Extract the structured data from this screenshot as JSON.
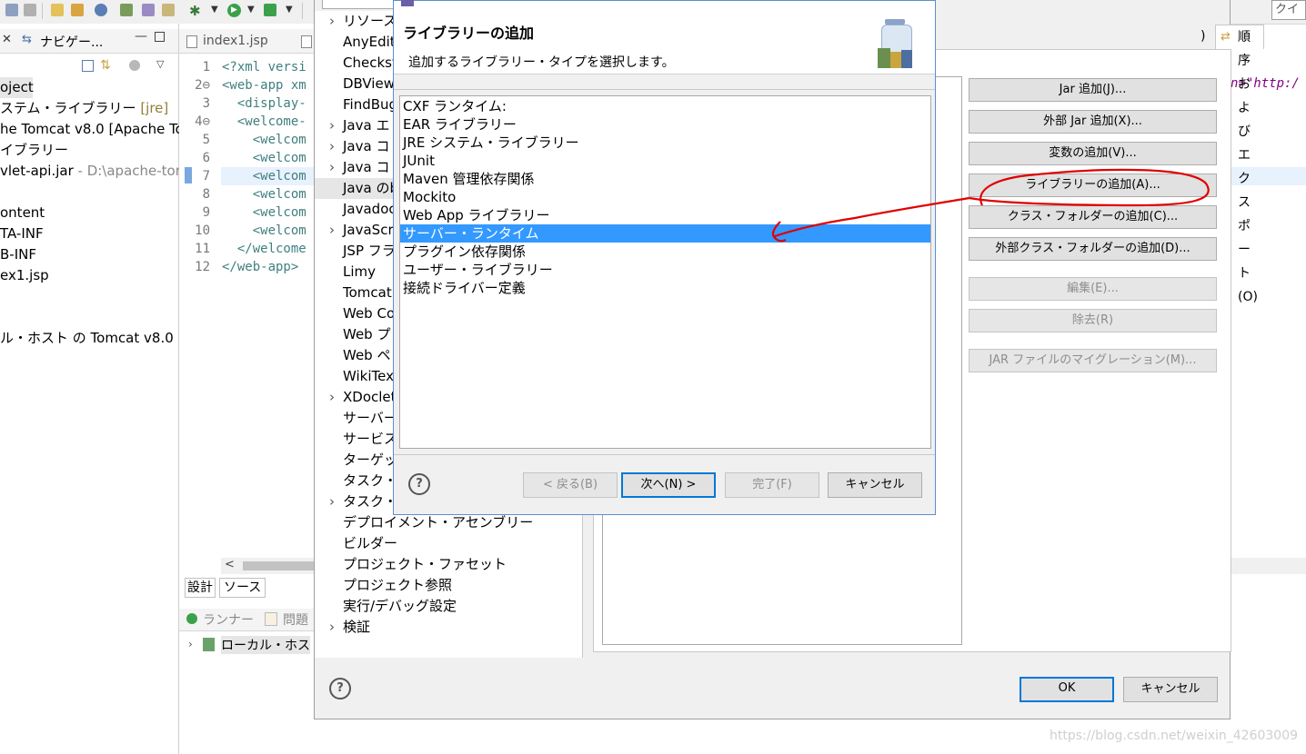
{
  "toolbar": {
    "quick_access": "クイッ"
  },
  "navigator": {
    "tab_label": "ナビゲー...",
    "items": [
      {
        "text": "oject",
        "suffix": ""
      },
      {
        "text": "ステム・ライブラリー ",
        "suffix": "[jre]"
      },
      {
        "text": "he Tomcat v8.0 [Apache To",
        "suffix": ""
      },
      {
        "text": "イブラリー",
        "suffix": ""
      },
      {
        "text": "vlet-api.jar",
        "suffix": " - D:\\apache-tom"
      },
      {
        "text": "",
        "suffix": ""
      },
      {
        "text": "ontent",
        "suffix": ""
      },
      {
        "text": "TA-INF",
        "suffix": ""
      },
      {
        "text": "B-INF",
        "suffix": ""
      },
      {
        "text": "ex1.jsp",
        "suffix": ""
      },
      {
        "text": "",
        "suffix": ""
      },
      {
        "text": "",
        "suffix": ""
      },
      {
        "text": "ル・ホスト の Tomcat v8.0",
        "suffix": ""
      }
    ]
  },
  "editor": {
    "tab_label": "index1.jsp",
    "lines": [
      {
        "n": "1",
        "text": "<?xml versi"
      },
      {
        "n": "2⊖",
        "text": "<web-app xm"
      },
      {
        "n": "3",
        "text": "  <display-"
      },
      {
        "n": "4⊖",
        "text": "  <welcome-"
      },
      {
        "n": "5",
        "text": "    <welcom"
      },
      {
        "n": "6",
        "text": "    <welcom"
      },
      {
        "n": "7",
        "text": "    <welcom"
      },
      {
        "n": "8",
        "text": "    <welcom"
      },
      {
        "n": "9",
        "text": "    <welcom"
      },
      {
        "n": "10",
        "text": "    <welcom"
      },
      {
        "n": "11",
        "text": "  </welcome"
      },
      {
        "n": "12",
        "text": "</web-app>"
      }
    ],
    "bottom_tabs": [
      "設計",
      "ソース"
    ],
    "right_code_fragment": "n=\"http:/"
  },
  "bottom_panel": {
    "tabs": [
      "ランナー",
      "問題"
    ],
    "server_item": "ローカル・ホス"
  },
  "properties_tree": {
    "items": [
      {
        "label": "リソース",
        "arrow": true
      },
      {
        "label": "AnyEdit",
        "arrow": false
      },
      {
        "label": "Checkst",
        "arrow": false
      },
      {
        "label": "DBView",
        "arrow": false
      },
      {
        "label": "FindBug",
        "arrow": false
      },
      {
        "label": "Java エ",
        "arrow": true
      },
      {
        "label": "Java コ",
        "arrow": true
      },
      {
        "label": "Java コ",
        "arrow": true
      },
      {
        "label": "Java のb",
        "arrow": false,
        "selected": true
      },
      {
        "label": "Javadoc",
        "arrow": false
      },
      {
        "label": "JavaScri",
        "arrow": true
      },
      {
        "label": "JSP フラ",
        "arrow": false
      },
      {
        "label": "Limy",
        "arrow": false
      },
      {
        "label": "Tomcat",
        "arrow": false
      },
      {
        "label": "Web Co",
        "arrow": false
      },
      {
        "label": "Web プ",
        "arrow": false
      },
      {
        "label": "Web ペ",
        "arrow": false
      },
      {
        "label": "WikiTex",
        "arrow": false
      },
      {
        "label": "XDoclet",
        "arrow": true
      },
      {
        "label": "サーバー",
        "arrow": false
      },
      {
        "label": "サービス",
        "arrow": false
      },
      {
        "label": "ターゲッ",
        "arrow": false
      },
      {
        "label": "タスク・",
        "arrow": false
      },
      {
        "label": "タスク・",
        "arrow": true
      },
      {
        "label": "デプロイメント・アセンブリー",
        "arrow": false
      },
      {
        "label": "ビルダー",
        "arrow": false
      },
      {
        "label": "プロジェクト・ファセット",
        "arrow": false
      },
      {
        "label": "プロジェクト参照",
        "arrow": false
      },
      {
        "label": "実行/デバッグ設定",
        "arrow": false
      },
      {
        "label": "検証",
        "arrow": true
      }
    ]
  },
  "properties": {
    "tab_partial": ")",
    "tab_order_export": "順序およびエクスポート(O)",
    "buttons": {
      "add_jar": "Jar 追加(J)...",
      "add_external_jar": "外部 Jar 追加(X)...",
      "add_variable": "変数の追加(V)...",
      "add_library": "ライブラリーの追加(A)...",
      "add_class_folder": "クラス・フォルダーの追加(C)...",
      "add_external_class_folder": "外部クラス・フォルダーの追加(D)...",
      "edit": "編集(E)...",
      "remove": "除去(R)",
      "migrate_jar": "JAR ファイルのマイグレーション(M)..."
    },
    "ok": "OK",
    "cancel": "キャンセル"
  },
  "dialog": {
    "title": "ライブラリーの追加",
    "subtitle": "追加するライブラリー・タイプを選択します。",
    "items": [
      "CXF ランタイム:",
      "EAR ライブラリー",
      "JRE システム・ライブラリー",
      "JUnit",
      "Maven 管理依存関係",
      "Mockito",
      "Web App ライブラリー",
      "サーバー・ランタイム",
      "プラグイン依存関係",
      "ユーザー・ライブラリー",
      "接続ドライバー定義"
    ],
    "selected_index": 7,
    "back": "< 戻る(B)",
    "next": "次へ(N) >",
    "finish": "完了(F)",
    "cancel": "キャンセル"
  },
  "watermark": "https://blog.csdn.net/weixin_42603009",
  "colors": {
    "selection": "#3399ff",
    "annotation": "#e00000",
    "focus_border": "#0078d7"
  }
}
